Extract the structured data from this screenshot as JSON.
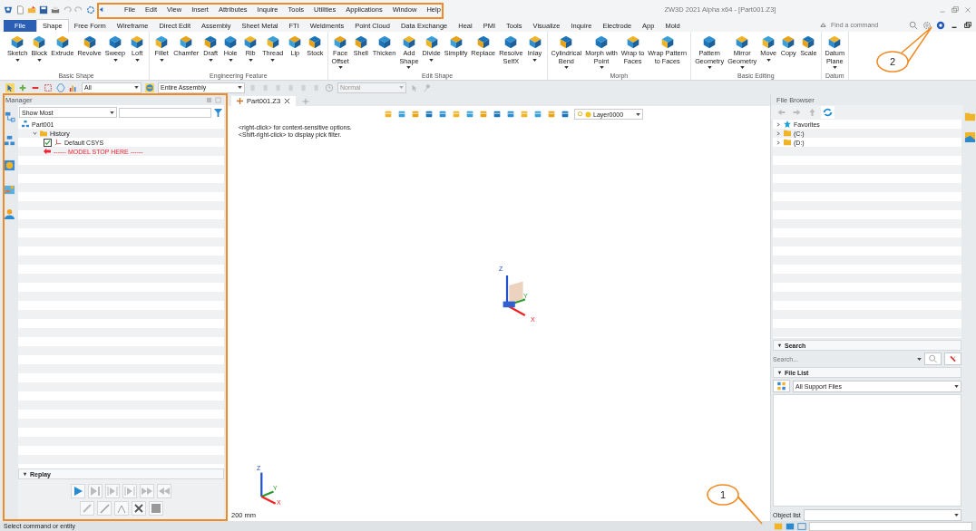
{
  "window": {
    "title": "ZW3D 2021 Alpha x64 - [Part001.Z3]"
  },
  "menu": [
    "File",
    "Edit",
    "View",
    "Insert",
    "Attributes",
    "Inquire",
    "Tools",
    "Utilities",
    "Applications",
    "Window",
    "Help"
  ],
  "ribbon_tabs": [
    {
      "label": "File",
      "kind": "file",
      "selected": false
    },
    {
      "label": "Shape",
      "kind": "tab",
      "selected": true
    },
    {
      "label": "Free Form",
      "kind": "tab",
      "selected": false
    },
    {
      "label": "Wireframe",
      "kind": "tab",
      "selected": false
    },
    {
      "label": "Direct Edit",
      "kind": "tab",
      "selected": false
    },
    {
      "label": "Assembly",
      "kind": "tab",
      "selected": false
    },
    {
      "label": "Sheet Metal",
      "kind": "tab",
      "selected": false
    },
    {
      "label": "FTI",
      "kind": "tab",
      "selected": false
    },
    {
      "label": "Weldments",
      "kind": "tab",
      "selected": false
    },
    {
      "label": "Point Cloud",
      "kind": "tab",
      "selected": false
    },
    {
      "label": "Data Exchange",
      "kind": "tab",
      "selected": false
    },
    {
      "label": "Heal",
      "kind": "tab",
      "selected": false
    },
    {
      "label": "PMI",
      "kind": "tab",
      "selected": false
    },
    {
      "label": "Tools",
      "kind": "tab",
      "selected": false
    },
    {
      "label": "Visualize",
      "kind": "tab",
      "selected": false
    },
    {
      "label": "Inquire",
      "kind": "tab",
      "selected": false
    },
    {
      "label": "Electrode",
      "kind": "tab",
      "selected": false
    },
    {
      "label": "App",
      "kind": "tab",
      "selected": false
    },
    {
      "label": "Mold",
      "kind": "tab",
      "selected": false
    }
  ],
  "command_search": {
    "placeholder": "Find a command"
  },
  "ribbon_groups": [
    {
      "title": "Basic Shape",
      "buttons": [
        {
          "label": "Sketch",
          "dropdown": true
        },
        {
          "label": "Block",
          "dropdown": true
        },
        {
          "label": "Extrude",
          "dropdown": false
        },
        {
          "label": "Revolve",
          "dropdown": false
        },
        {
          "label": "Sweep",
          "dropdown": true
        },
        {
          "label": "Loft",
          "dropdown": true
        }
      ]
    },
    {
      "title": "Engineering Feature",
      "buttons": [
        {
          "label": "Fillet",
          "dropdown": true
        },
        {
          "label": "Chamfer",
          "dropdown": false
        },
        {
          "label": "Draft",
          "dropdown": true
        },
        {
          "label": "Hole",
          "dropdown": true
        },
        {
          "label": "Rib",
          "dropdown": true
        },
        {
          "label": "Thread",
          "dropdown": true
        },
        {
          "label": "Lip",
          "dropdown": false
        },
        {
          "label": "Stock",
          "dropdown": false
        }
      ]
    },
    {
      "title": "Edit Shape",
      "buttons": [
        {
          "label": "Face\nOffset",
          "dropdown": true
        },
        {
          "label": "Shell",
          "dropdown": false
        },
        {
          "label": "Thicken",
          "dropdown": false
        },
        {
          "label": "Add\nShape",
          "dropdown": true
        },
        {
          "label": "Divide",
          "dropdown": true
        },
        {
          "label": "Simplify",
          "dropdown": false
        },
        {
          "label": "Replace",
          "dropdown": false
        },
        {
          "label": "Resolve\nSelfX",
          "dropdown": false
        },
        {
          "label": "Inlay",
          "dropdown": true
        }
      ]
    },
    {
      "title": "Morph",
      "buttons": [
        {
          "label": "Cylindrical\nBend",
          "dropdown": true
        },
        {
          "label": "Morph with\nPoint",
          "dropdown": true
        },
        {
          "label": "Wrap to\nFaces",
          "dropdown": false
        },
        {
          "label": "Wrap Pattern\nto Faces",
          "dropdown": false
        }
      ]
    },
    {
      "title": "Basic Editing",
      "buttons": [
        {
          "label": "Pattern\nGeometry",
          "dropdown": true
        },
        {
          "label": "Mirror\nGeometry",
          "dropdown": true
        },
        {
          "label": "Move",
          "dropdown": true
        },
        {
          "label": "Copy",
          "dropdown": false
        },
        {
          "label": "Scale",
          "dropdown": false
        }
      ]
    },
    {
      "title": "Datum",
      "buttons": [
        {
          "label": "Datum\nPlane",
          "dropdown": true
        }
      ]
    }
  ],
  "selection_toolbar": {
    "filter": "All",
    "scope": "Entire Assembly",
    "mode": "Normal"
  },
  "manager": {
    "title": "Manager",
    "view": "Show Most",
    "tree": [
      {
        "label": "Part001",
        "kind": "part",
        "children": [
          {
            "label": "History",
            "kind": "folder",
            "expanded": true,
            "children": [
              {
                "label": "Default CSYS",
                "kind": "csys",
                "checked": true
              },
              {
                "label": "------ MODEL STOP HERE ------",
                "kind": "stop"
              }
            ]
          }
        ]
      }
    ],
    "replay": {
      "title": "Replay",
      "expanded": true
    }
  },
  "viewport": {
    "tab": {
      "label": "Part001.Z3",
      "selected": true
    },
    "layer": "Layer0000",
    "hints": [
      "<right-click> for context-sensitive options.",
      "<Shift-right-click> to display pick filter."
    ],
    "triad": {
      "labels": [
        "Z",
        "Y",
        "X"
      ]
    },
    "corner_triad": {
      "labels": [
        "Z",
        "Y",
        "X"
      ]
    },
    "scale": "200 mm"
  },
  "file_browser": {
    "title": "File Browser",
    "tree": [
      {
        "label": "Favorites",
        "kind": "favorites",
        "expanded": false
      },
      {
        "label": "(C:)",
        "kind": "drive",
        "expanded": false
      },
      {
        "label": "(D:)",
        "kind": "drive",
        "expanded": false
      }
    ],
    "search": {
      "title": "Search",
      "placeholder": "Search...",
      "expanded": true
    },
    "file_list": {
      "title": "File List",
      "filter": "All Support Files",
      "expanded": true
    },
    "object_list": {
      "label": "Object list"
    }
  },
  "status_bar": {
    "text": "Select command or entity"
  },
  "callouts": [
    {
      "label": "1"
    },
    {
      "label": "2"
    }
  ]
}
